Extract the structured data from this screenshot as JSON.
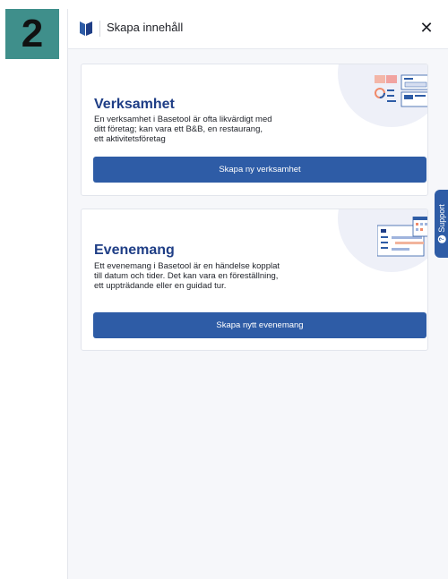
{
  "step_badge": "2",
  "header": {
    "title": "Skapa innehåll",
    "close_glyph": "✕"
  },
  "cards": [
    {
      "title": "Verksamhet",
      "description": "En verksamhet i Basetool är ofta likvärdigt med ditt företag; kan vara ett B&B, en restaurang, ett aktivitetsföretag",
      "button_label": "Skapa ny verksamhet"
    },
    {
      "title": "Evenemang",
      "description": "Ett evenemang i Basetool är en händelse kopplat till datum och tider. Det kan vara en föreställning, ett uppträdande eller en guidad tur.",
      "button_label": "Skapa nytt evenemang"
    }
  ],
  "support": {
    "label": "Support",
    "icon_glyph": "?"
  },
  "colors": {
    "primary": "#2e5ca6",
    "title": "#1f3e86",
    "badge": "#3f8f8b"
  }
}
